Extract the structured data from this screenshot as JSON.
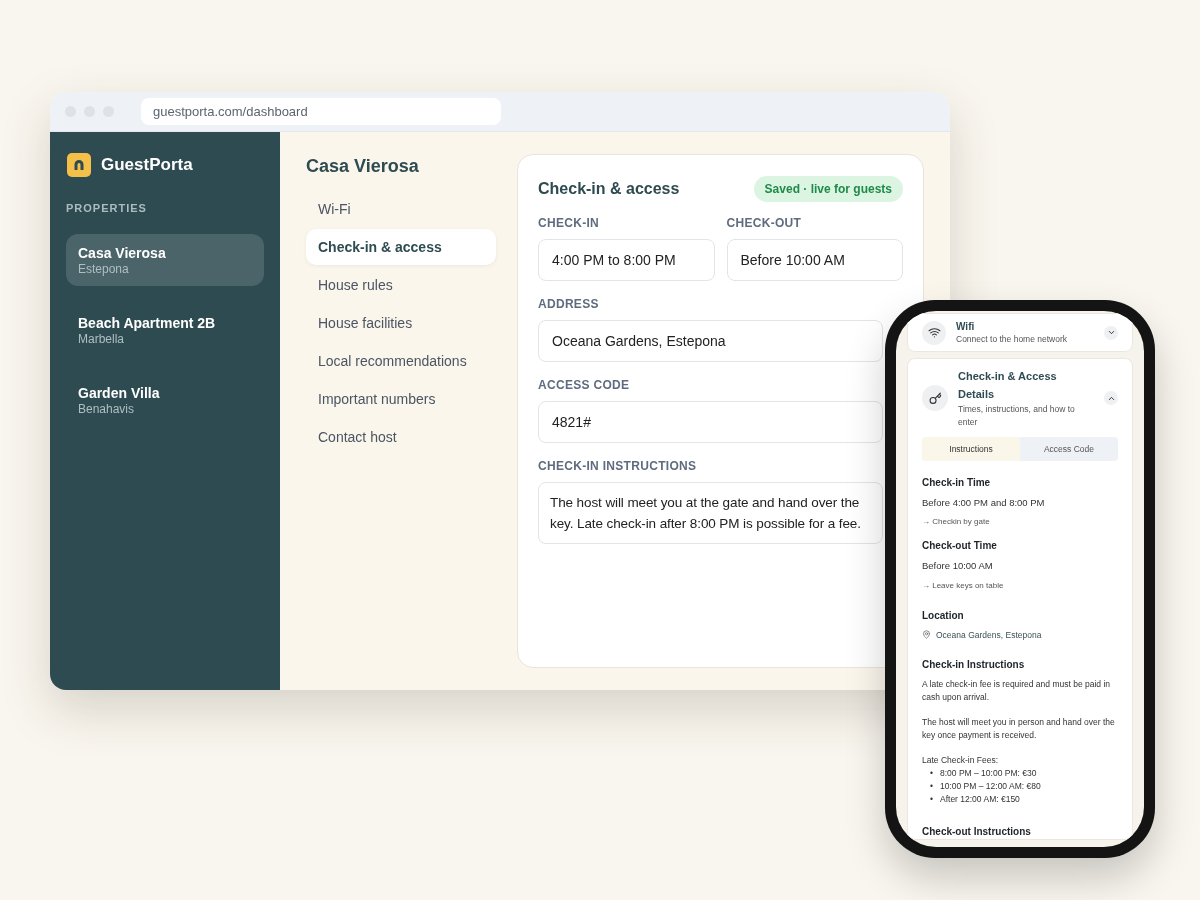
{
  "browser": {
    "url": "guestporta.com/dashboard"
  },
  "sidebar": {
    "brand": "GuestPorta",
    "section": "PROPERTIES",
    "properties": [
      {
        "name": "Casa Vierosa",
        "location": "Estepona",
        "selected": true
      },
      {
        "name": "Beach Apartment 2B",
        "location": "Marbella",
        "selected": false
      },
      {
        "name": "Garden Villa",
        "location": "Benahavis",
        "selected": false
      }
    ]
  },
  "nav": {
    "title": "Casa Vierosa",
    "items": [
      {
        "label": "Wi-Fi",
        "selected": false
      },
      {
        "label": "Check-in & access",
        "selected": true
      },
      {
        "label": "House rules",
        "selected": false
      },
      {
        "label": "House facilities",
        "selected": false
      },
      {
        "label": "Local recommendations",
        "selected": false
      },
      {
        "label": "Important numbers",
        "selected": false
      },
      {
        "label": "Contact host",
        "selected": false
      }
    ]
  },
  "form": {
    "title": "Check-in & access",
    "status": "Saved · live for guests",
    "fields": [
      {
        "kind": "short",
        "label": "CHECK-IN",
        "value": "4:00 PM to 8:00 PM"
      },
      {
        "kind": "short",
        "label": "CHECK-OUT",
        "value": "Before 10:00 AM"
      },
      {
        "kind": "input",
        "label": "ADDRESS",
        "value": "Oceana Gardens, Estepona"
      },
      {
        "kind": "input",
        "label": "ACCESS CODE",
        "value": "4821#"
      },
      {
        "kind": "textarea",
        "label": "CHECK-IN INSTRUCTIONS",
        "value": "The host will meet you at the gate and hand over the key. Late check-in after 8:00 PM is possible for a fee."
      }
    ]
  },
  "phone": {
    "wifi_card": {
      "title": "Wifi",
      "subtitle": "Connect to the home network",
      "expanded": false
    },
    "access_card": {
      "title": "Check-in & Access Details",
      "subtitle": "Times, instructions, and how to enter",
      "expanded": true,
      "tabs": [
        {
          "label": "Instructions",
          "selected": true
        },
        {
          "label": "Access Code",
          "selected": false
        }
      ],
      "sections": [
        {
          "kind": "time",
          "heading": "Check-in Time",
          "value": "Before 4:00 PM and 8:00 PM",
          "note": "→ Checkin by gate"
        },
        {
          "kind": "time",
          "heading": "Check-out Time",
          "value": "Before 10:00 AM",
          "note": "→ Leave keys on table"
        },
        {
          "kind": "location",
          "heading": "Location",
          "value": "Oceana Gardens, Estepona"
        },
        {
          "kind": "text",
          "heading": "Check-in Instructions",
          "paragraphs": [
            "A late check-in fee is required and must be paid in cash upon arrival.",
            "The host will meet you in person and hand over the key once payment is received."
          ],
          "list_title": "Late Check-in Fees:",
          "bullet": "•",
          "list": [
            "8:00 PM – 10:00 PM: €30",
            "10:00 PM – 12:00 AM: €80",
            "After 12:00 AM: €150"
          ]
        },
        {
          "kind": "heading",
          "heading": "Check-out Instructions"
        }
      ]
    }
  }
}
